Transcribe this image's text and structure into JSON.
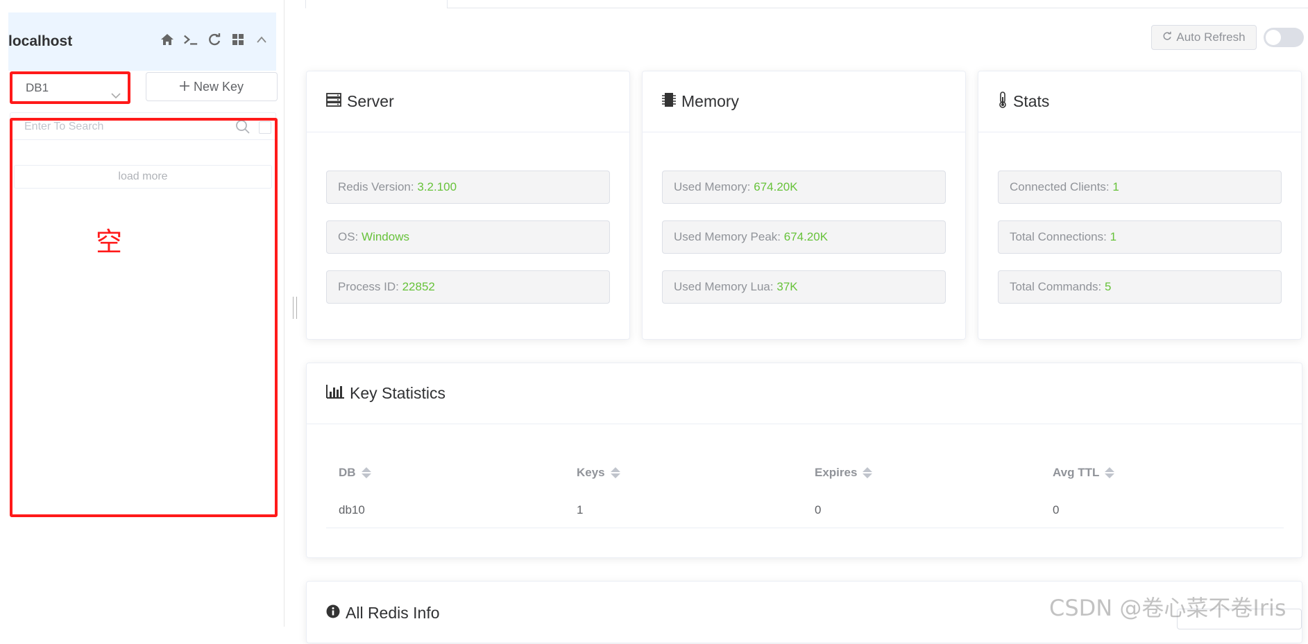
{
  "sidebar": {
    "connection_name": "localhost",
    "icons": [
      "home-icon",
      "terminal-icon",
      "refresh-icon",
      "grid-icon",
      "chevron-up-icon"
    ],
    "db_select": {
      "value": "DB1"
    },
    "new_key_label": "New Key",
    "search": {
      "placeholder": "Enter To Search"
    },
    "load_more_label": "load more",
    "annotation_text": "空",
    "annotation_color": "#ff1a1a"
  },
  "main": {
    "auto_refresh_label": "Auto Refresh",
    "auto_refresh_on": false,
    "server": {
      "title": "Server",
      "rows": [
        {
          "label": "Redis Version:",
          "value": "3.2.100"
        },
        {
          "label": "OS:",
          "value": "Windows"
        },
        {
          "label": "Process ID:",
          "value": "22852"
        }
      ]
    },
    "memory": {
      "title": "Memory",
      "rows": [
        {
          "label": "Used Memory:",
          "value": "674.20K"
        },
        {
          "label": "Used Memory Peak:",
          "value": "674.20K"
        },
        {
          "label": "Used Memory Lua:",
          "value": "37K"
        }
      ]
    },
    "stats": {
      "title": "Stats",
      "rows": [
        {
          "label": "Connected Clients:",
          "value": "1"
        },
        {
          "label": "Total Connections:",
          "value": "1"
        },
        {
          "label": "Total Commands:",
          "value": "5"
        }
      ]
    },
    "key_statistics": {
      "title": "Key Statistics",
      "columns": [
        "DB",
        "Keys",
        "Expires",
        "Avg TTL"
      ],
      "rows": [
        [
          "db10",
          "1",
          "0",
          "0"
        ]
      ]
    },
    "all_info_title": "All Redis Info",
    "value_color": "#67c23a"
  },
  "watermark": "CSDN @卷心菜不卷Iris"
}
